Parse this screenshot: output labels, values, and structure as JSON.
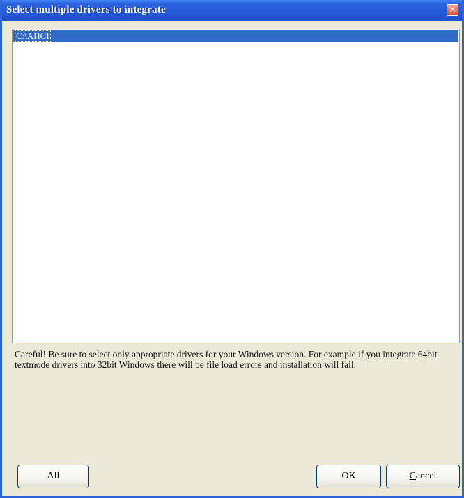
{
  "window": {
    "title": "Select multiple drivers to integrate",
    "close_icon": "close-icon"
  },
  "list": {
    "items": [
      {
        "label": "C:\\AHCI",
        "selected": true
      }
    ]
  },
  "warning_text": "Careful! Be sure to select only appropriate drivers for your Windows version. For example if you integrate 64bit textmode drivers into 32bit Windows there will be file load errors and installation will fail.",
  "buttons": {
    "all_label": "All",
    "ok_label": "OK",
    "cancel_label_first": "C",
    "cancel_label_rest": "ancel"
  },
  "colors": {
    "title_bar": "#2559d6",
    "selection": "#316ac5",
    "dialog_bg": "#ece9d8"
  }
}
